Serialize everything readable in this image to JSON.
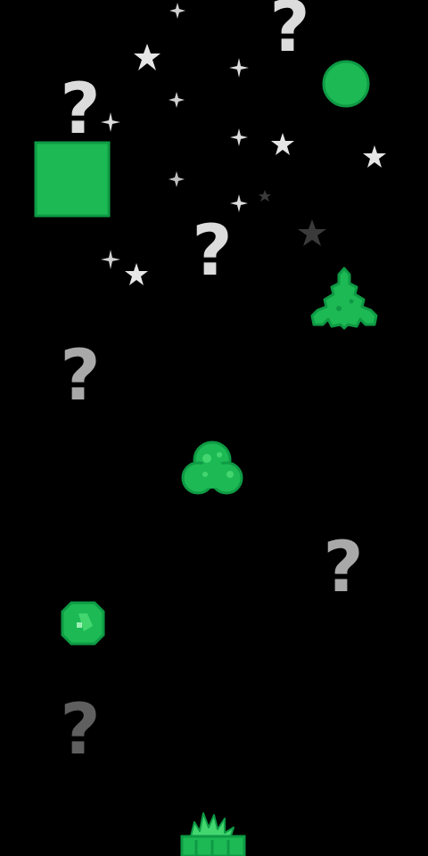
{
  "colors": {
    "background": "#000000",
    "green": "#1db954",
    "green_dark": "#0e9a44",
    "green_light": "#43d66f",
    "star_white": "#e6e6e6",
    "star_dark": "#3a3a3a",
    "qmark_light": "#dcdcdc",
    "qmark_mid": "#a9a9a9",
    "qmark_dark": "#5f5f5f"
  },
  "question_marks": [
    {
      "glyph": "?",
      "shade": "qmark_light"
    },
    {
      "glyph": "?",
      "shade": "qmark_light"
    },
    {
      "glyph": "?",
      "shade": "qmark_light"
    },
    {
      "glyph": "?",
      "shade": "qmark_mid"
    },
    {
      "glyph": "?",
      "shade": "qmark_mid"
    },
    {
      "glyph": "?",
      "shade": "qmark_dark"
    }
  ],
  "pieces": [
    {
      "name": "green-square-block",
      "icon": "square-block-icon"
    },
    {
      "name": "green-circle-orb",
      "icon": "circle-orb-icon"
    },
    {
      "name": "green-pine-tree",
      "icon": "pine-tree-icon"
    },
    {
      "name": "green-cloud-blob",
      "icon": "cloud-blob-icon"
    },
    {
      "name": "green-gem",
      "icon": "gem-icon"
    },
    {
      "name": "green-grass-plant",
      "icon": "grass-plant-icon"
    }
  ]
}
